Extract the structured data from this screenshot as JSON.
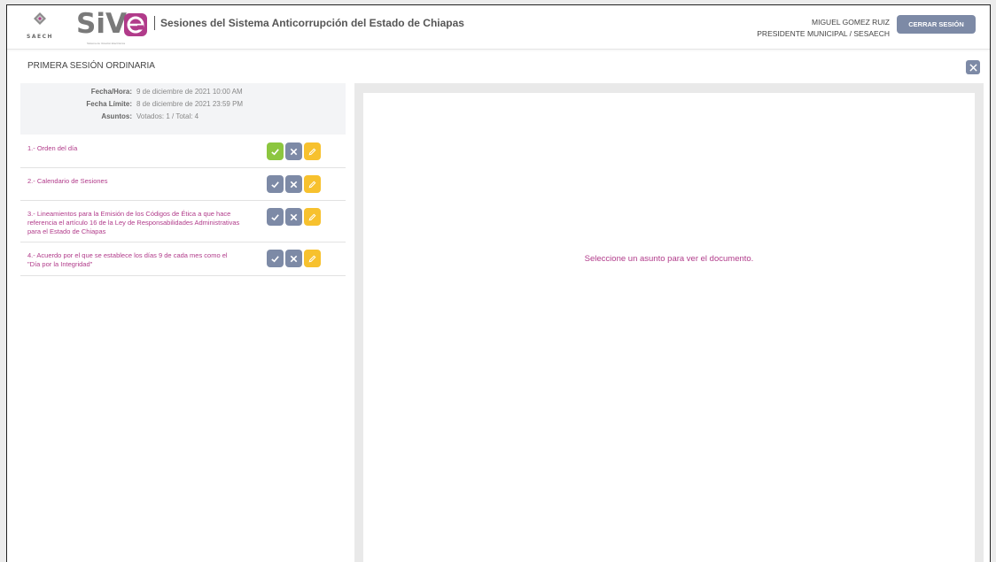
{
  "header": {
    "logo_secretaria_text": "SAECH",
    "logo_sive_text": "SiV",
    "logo_sive_subtitle": "Sistema de Votación Electrónica",
    "title": "Sesiones del Sistema Anticorrupción del Estado de Chiapas",
    "user_name": "MIGUEL GOMEZ RUIZ",
    "user_role": "PRESIDENTE MUNICIPAL / SESAECH",
    "logout_label": "CERRAR SESIÓN"
  },
  "session": {
    "title": "PRIMERA SESIÓN ORDINARIA",
    "info": [
      {
        "label": "Fecha/Hora:",
        "value": "9 de diciembre de 2021 10:00 AM"
      },
      {
        "label": "Fecha Límite:",
        "value": "8 de diciembre de 2021 23:59 PM"
      },
      {
        "label": "Asuntos:",
        "value": "Votados: 1 / Total: 4"
      }
    ],
    "topics": [
      {
        "text": "1.- Orden del día",
        "approved": true
      },
      {
        "text": "2.- Calendario de Sesiones",
        "approved": false
      },
      {
        "text": "3.- Lineamientos para la Emisión de los Códigos de Ética a que hace referencia el artículo 16 de la Ley de Responsabilidades Administrativas para el Estado de Chiapas",
        "approved": false
      },
      {
        "text": "4.- Acuerdo por el que se establece los días 9 de cada mes como el \"Día por la Integridad\"",
        "approved": false
      }
    ]
  },
  "viewer": {
    "message": "Seleccione un asunto para ver el documento."
  },
  "colors": {
    "accent": "#b13b8a",
    "button": "#7d8aa6",
    "approved": "#8cc63f",
    "edit": "#f7c12e"
  }
}
